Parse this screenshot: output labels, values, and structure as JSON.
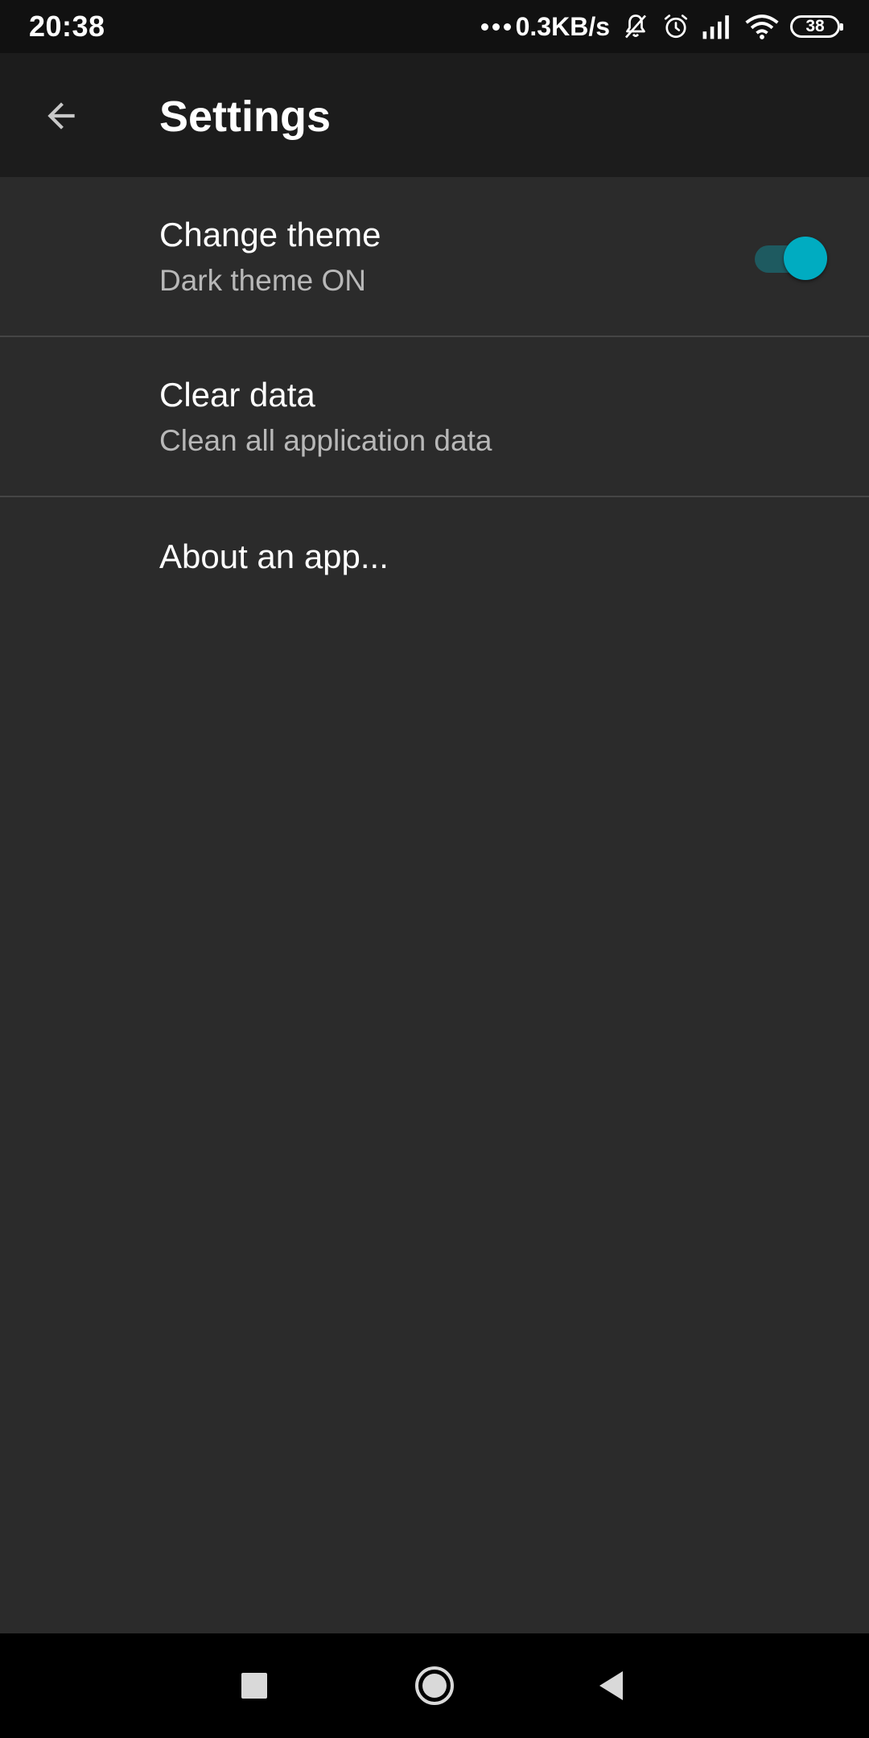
{
  "status_bar": {
    "time": "20:38",
    "network_speed": "0.3KB/s",
    "battery_level": "38",
    "icons": [
      "notification-dots-icon",
      "muted-bell-icon",
      "alarm-icon",
      "signal-icon",
      "wifi-icon",
      "battery-icon"
    ]
  },
  "app_bar": {
    "title": "Settings",
    "back_icon": "arrow-back-icon"
  },
  "settings": {
    "items": [
      {
        "title": "Change theme",
        "subtitle": "Dark theme ON",
        "toggle_on": true
      },
      {
        "title": "Clear data",
        "subtitle": "Clean all application data"
      },
      {
        "title": "About an app..."
      }
    ]
  },
  "nav_bar": {
    "icons": [
      "recents-square-icon",
      "home-circle-icon",
      "back-triangle-icon"
    ]
  },
  "colors": {
    "background": "#2b2b2b",
    "app_bar": "#1c1c1c",
    "accent": "#00acc1",
    "divider": "#454545"
  }
}
